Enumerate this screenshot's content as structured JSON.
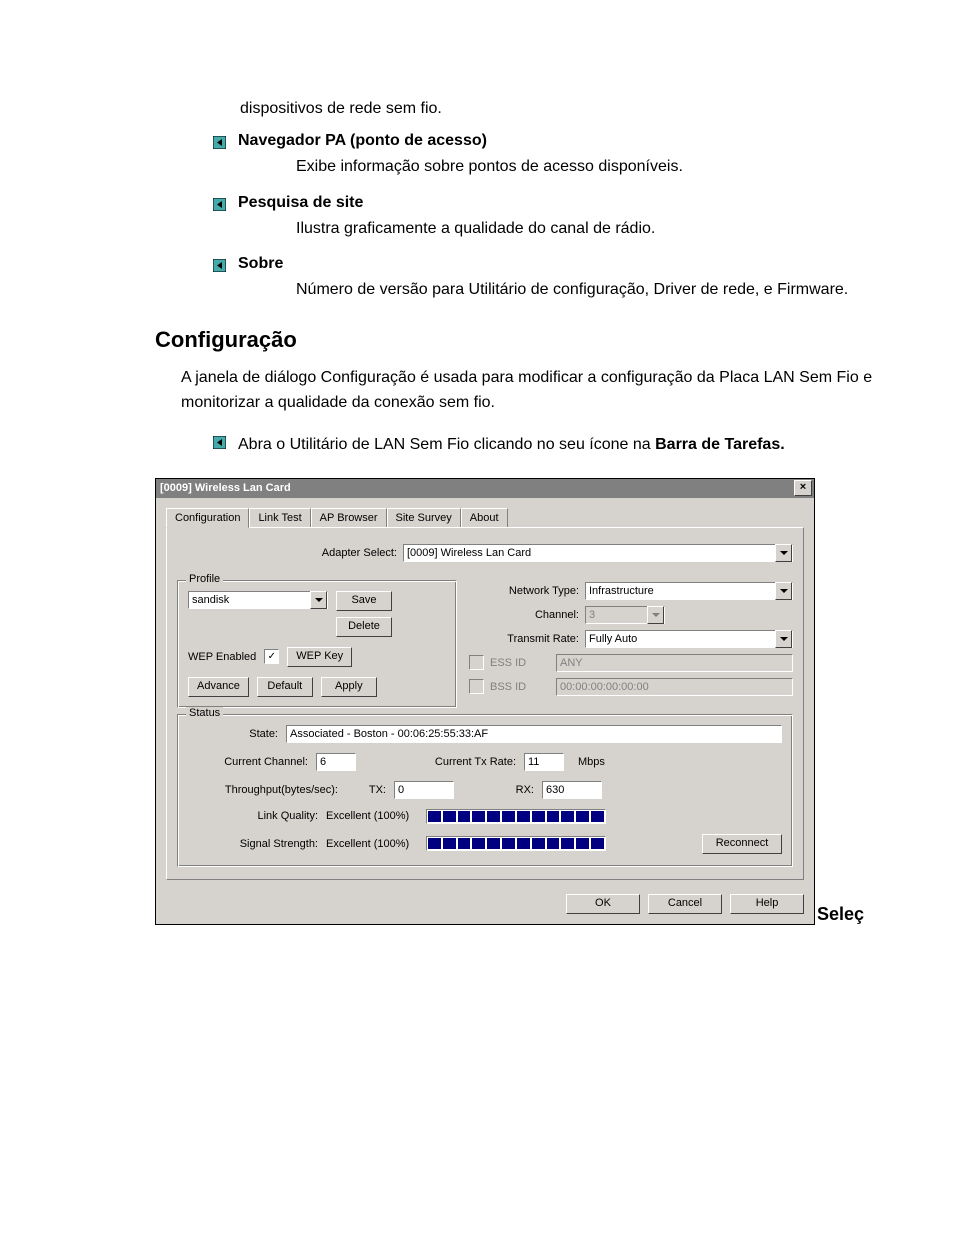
{
  "doc": {
    "intro_fragment": "dispositivos de rede sem fio.",
    "bullets": [
      {
        "title": "Navegador PA (ponto de acesso)",
        "desc": "Exibe informação sobre pontos de acesso disponíveis."
      },
      {
        "title": "Pesquisa de site",
        "desc": "Ilustra graficamente a qualidade do canal de rádio."
      },
      {
        "title": "Sobre",
        "desc": "Número de versão para Utilitário de configuração, Driver de rede, e Firmware."
      }
    ],
    "section_heading": "Configuração",
    "section_body": "A janela de diálogo Configuração  é usada para modificar a configuração da Placa LAN Sem Fio e monitorizar a qualidade da conexão sem fio.",
    "step_prefix": "Abra o Utilitário de LAN Sem Fio clicando no seu ícone na ",
    "step_bold": "Barra de Tarefas.",
    "trailing_word": "Seleç"
  },
  "dialog": {
    "title": "[0009] Wireless Lan Card",
    "close_glyph": "×",
    "tabs": [
      "Configuration",
      "Link Test",
      "AP Browser",
      "Site Survey",
      "About"
    ],
    "adapter_label": "Adapter Select:",
    "adapter_value": "[0009] Wireless Lan Card",
    "profile": {
      "group_title": "Profile",
      "value": "sandisk",
      "save": "Save",
      "delete": "Delete",
      "wep_label": "WEP Enabled",
      "wep_checked": "✓",
      "wep_key": "WEP Key",
      "advance": "Advance",
      "default": "Default",
      "apply": "Apply"
    },
    "net": {
      "type_label": "Network Type:",
      "type_value": "Infrastructure",
      "channel_label": "Channel:",
      "channel_value": "3",
      "rate_label": "Transmit Rate:",
      "rate_value": "Fully Auto",
      "essid_label": "ESS ID",
      "essid_value": "ANY",
      "bssid_label": "BSS ID",
      "bssid_value": "00:00:00:00:00:00"
    },
    "status": {
      "group_title": "Status",
      "state_label": "State:",
      "state_value": "Associated - Boston - 00:06:25:55:33:AF",
      "chan_label": "Current Channel:",
      "chan_value": "6",
      "txrate_label": "Current Tx Rate:",
      "txrate_value": "11",
      "txrate_unit": "Mbps",
      "throughput_label": "Throughput(bytes/sec):",
      "tx_label": "TX:",
      "tx_value": "0",
      "rx_label": "RX:",
      "rx_value": "630",
      "link_label": "Link Quality:",
      "link_value": "Excellent (100%)",
      "signal_label": "Signal Strength:",
      "signal_value": "Excellent (100%)",
      "reconnect": "Reconnect"
    },
    "footer": {
      "ok": "OK",
      "cancel": "Cancel",
      "help": "Help"
    }
  }
}
